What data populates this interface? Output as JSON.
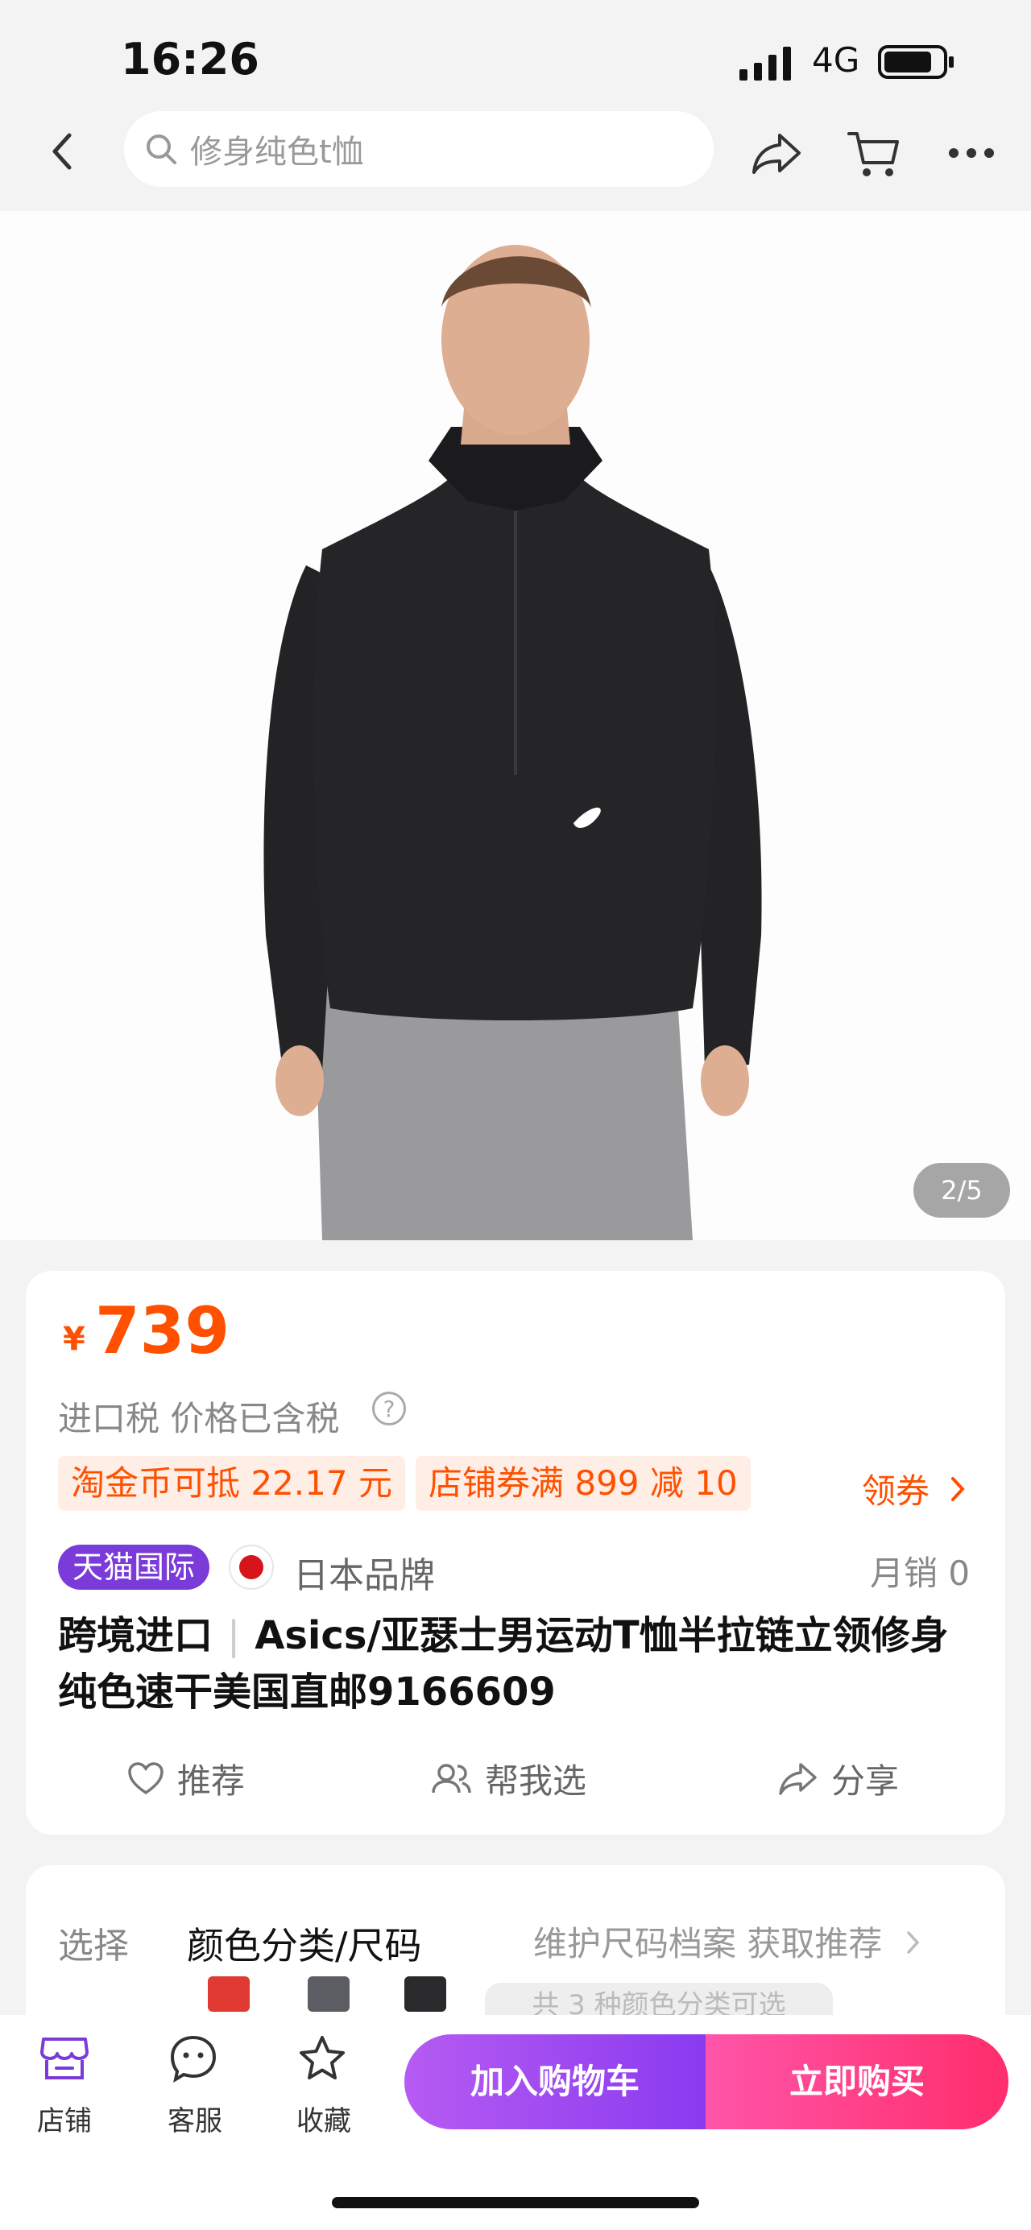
{
  "status": {
    "time": "16:26",
    "network": "4G"
  },
  "nav": {
    "search_placeholder": "修身纯色t恤"
  },
  "gallery": {
    "pager": "2/5"
  },
  "price": {
    "symbol": "¥",
    "amount": "739",
    "tax_note": "进口税 价格已含税"
  },
  "promos": {
    "coin_chip": "淘金币可抵 22.17 元",
    "shop_chip": "店铺券满 899 减 10",
    "get_coupon": "领券"
  },
  "product": {
    "tmall_badge": "天猫国际",
    "brand_origin": "日本品牌",
    "monthly_sales": "月销 0",
    "title_prefix": "跨境进口",
    "title_main": "Asics/亚瑟士男运动T恤半拉链立领修身纯色速干美国直邮9166609"
  },
  "actions": {
    "recommend": "推荐",
    "help_choose": "帮我选",
    "share": "分享"
  },
  "selection": {
    "label": "选择",
    "value": "颜色分类/尺码",
    "hint": "维护尺码档案 获取推荐",
    "variants_note": "共 3 种颜色分类可选"
  },
  "bottom_bar": {
    "shop": "店铺",
    "service": "客服",
    "favorite": "收藏",
    "add_to_cart": "加入购物车",
    "buy_now": "立即购买"
  },
  "colors": {
    "price": "#ff5000",
    "tmall": "#7a3bd9",
    "cart_button": "#9b47f1",
    "buy_button": "#ff3a7f"
  }
}
